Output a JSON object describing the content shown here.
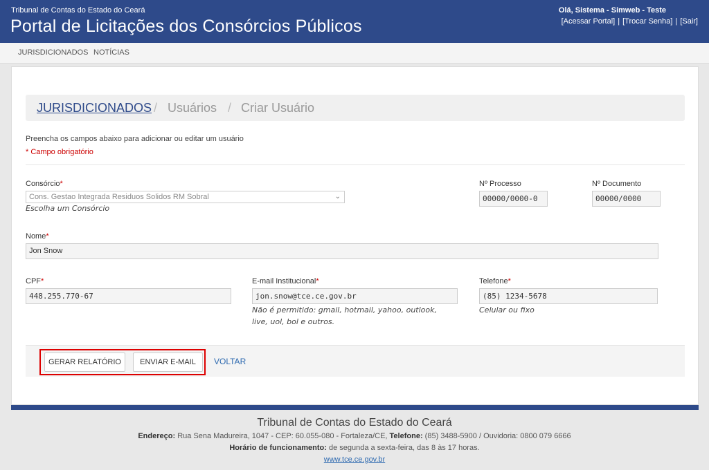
{
  "header": {
    "org": "Tribunal de Contas do Estado do Ceará",
    "title": "Portal de Licitações dos Consórcios Públicos",
    "greeting": "Olá, Sistema - Simweb - Teste",
    "links": [
      "[Acessar Portal]",
      "[Trocar Senha]",
      "[Sair]"
    ],
    "link_separator": "|"
  },
  "menu": {
    "items": [
      "JURISDICIONADOS",
      "NOTÍCIAS"
    ]
  },
  "breadcrumb": {
    "items": [
      "JURISDICIONADOS",
      "Usuários",
      "Criar Usuário"
    ],
    "separator": "/"
  },
  "form": {
    "intro": "Preencha os campos abaixo para adicionar ou editar um usuário",
    "required_note": "* Campo obrigatório",
    "required_marker": "*",
    "consorcio": {
      "label": "Consórcio",
      "value": "Cons. Gestao Integrada Residuos Solidos RM Sobral",
      "help": "Escolha um Consórcio"
    },
    "processo": {
      "label": "Nº Processo",
      "placeholder": "00000/0000-0"
    },
    "documento": {
      "label": "Nº Documento",
      "placeholder": "00000/0000"
    },
    "nome": {
      "label": "Nome",
      "value": "Jon Snow"
    },
    "cpf": {
      "label": "CPF",
      "value": "448.255.770-67"
    },
    "email": {
      "label": "E-mail Institucional",
      "value": "jon.snow@tce.ce.gov.br",
      "help_line1": "Não é permitido: gmail, hotmail, yahoo, outlook,",
      "help_line2": "live, uol, bol e outros."
    },
    "telefone": {
      "label": "Telefone",
      "value": "(85) 1234-5678",
      "help": "Celular ou fixo"
    }
  },
  "actions": {
    "report": "GERAR RELATÓRIO",
    "email": "ENVIAR E-MAIL",
    "back": "VOLTAR"
  },
  "footer": {
    "title": "Tribunal de Contas do Estado do Ceará",
    "address_label": "Endereço:",
    "address": "Rua Sena Madureira, 1047 - CEP: 60.055-080 - Fortaleza/CE,",
    "phone_label": "Telefone:",
    "phone": "(85) 3488-5900 / Ouvidoria: 0800 079 6666",
    "hours_label": "Horário de funcionamento:",
    "hours": "de segunda a sexta-feira, das 8 às 17 horas.",
    "site": "www.tce.ce.gov.br"
  },
  "colors": {
    "brand": "#2e4a8a",
    "link": "#2e6ab0",
    "required": "#cc0000",
    "highlight": "#dd0000"
  }
}
